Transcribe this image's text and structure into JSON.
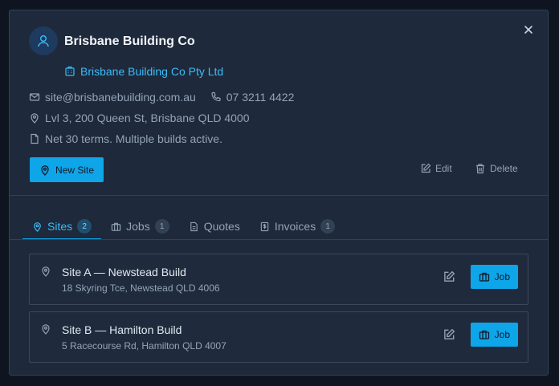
{
  "client": {
    "name": "Brisbane Building Co",
    "company": "Brisbane Building Co Pty Ltd",
    "email": "site@brisbanebuilding.com.au",
    "phone": "07 3211 4422",
    "address": "Lvl 3, 200 Queen St, Brisbane QLD 4000",
    "notes": "Net 30 terms. Multiple builds active."
  },
  "actions": {
    "new_site": "New Site",
    "edit": "Edit",
    "delete": "Delete"
  },
  "tabs": [
    {
      "label": "Sites",
      "count": "2",
      "icon": "map-pin-icon",
      "active": true
    },
    {
      "label": "Jobs",
      "count": "1",
      "icon": "briefcase-icon"
    },
    {
      "label": "Quotes",
      "count": "",
      "icon": "document-icon"
    },
    {
      "label": "Invoices",
      "count": "1",
      "icon": "receipt-icon"
    }
  ],
  "sites": [
    {
      "name": "Site A — Newstead Build",
      "address": "18 Skyring Tce, Newstead QLD 4006",
      "job_label": "Job"
    },
    {
      "name": "Site B — Hamilton Build",
      "address": "5 Racecourse Rd, Hamilton QLD 4007",
      "job_label": "Job"
    }
  ],
  "colors": {
    "accent": "#0ea5e9",
    "link": "#38bdf8",
    "modal_bg": "#1e293b",
    "backdrop": "#0f1520"
  }
}
